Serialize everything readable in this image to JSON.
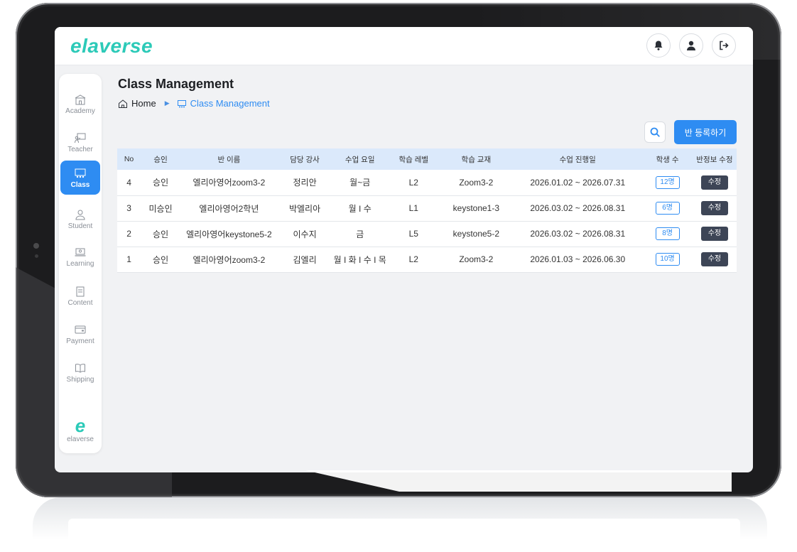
{
  "app": {
    "logo": "elaverse"
  },
  "sidebar": {
    "items": [
      {
        "label": "Academy"
      },
      {
        "label": "Teacher"
      },
      {
        "label": "Class"
      },
      {
        "label": "Student"
      },
      {
        "label": "Learning"
      },
      {
        "label": "Content"
      },
      {
        "label": "Payment"
      },
      {
        "label": "Shipping"
      }
    ],
    "footer_logo": "e",
    "footer_label": "elaverse"
  },
  "header": {
    "title": "Class Management"
  },
  "breadcrumb": {
    "home": "Home",
    "current": "Class Management"
  },
  "toolbar": {
    "register_label": "반 등록하기"
  },
  "table": {
    "columns": [
      "No",
      "승인",
      "반 이름",
      "담당 강사",
      "수업 요일",
      "학습 레벨",
      "학습 교재",
      "수업 진행일",
      "학생 수",
      "반정보 수정"
    ],
    "rows": [
      {
        "no": "4",
        "approval": "승인",
        "name": "엘리아영어zoom3-2",
        "teacher": "정리안",
        "days": "월~금",
        "level": "L2",
        "book": "Zoom3-2",
        "period": "2026.01.02 ~ 2026.07.31",
        "students": "12명",
        "edit": "수정"
      },
      {
        "no": "3",
        "approval": "미승인",
        "name": "엘리아영어2학년",
        "teacher": "박엘리아",
        "days": "월 I 수",
        "level": "L1",
        "book": "keystone1-3",
        "period": "2026.03.02 ~ 2026.08.31",
        "students": "6명",
        "edit": "수정"
      },
      {
        "no": "2",
        "approval": "승인",
        "name": "엘리아영어keystone5-2",
        "teacher": "이수지",
        "days": "금",
        "level": "L5",
        "book": "keystone5-2",
        "period": "2026.03.02 ~ 2026.08.31",
        "students": "8명",
        "edit": "수정"
      },
      {
        "no": "1",
        "approval": "승인",
        "name": "엘리아영어zoom3-2",
        "teacher": "김엘리",
        "days": "월 I 화 I 수 I 목",
        "level": "L2",
        "book": "Zoom3-2",
        "period": "2026.01.03 ~ 2026.06.30",
        "students": "10명",
        "edit": "수정"
      }
    ]
  },
  "colors": {
    "accent": "#2e8cf2",
    "brand": "#2ccab8",
    "header_row": "#dbe9fb"
  },
  "icons": [
    "bell-icon",
    "user-icon",
    "logout-icon",
    "search-icon",
    "home-icon",
    "class-board-icon"
  ]
}
